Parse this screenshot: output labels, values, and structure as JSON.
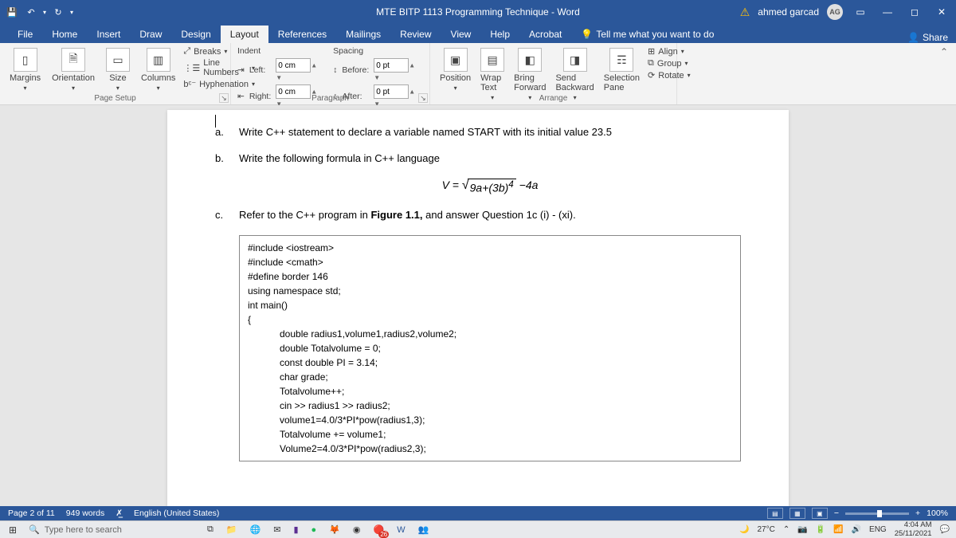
{
  "titlebar": {
    "title": "MTE BITP 1113 Programming Technique - Word",
    "username": "ahmed garcad",
    "avatar": "AG"
  },
  "tabs": {
    "file": "File",
    "items": [
      "Home",
      "Insert",
      "Draw",
      "Design",
      "Layout",
      "References",
      "Mailings",
      "Review",
      "View",
      "Help",
      "Acrobat"
    ],
    "tellme": "Tell me what you want to do",
    "share": "Share"
  },
  "ribbon": {
    "pagesetup": {
      "margins": "Margins",
      "orientation": "Orientation",
      "size": "Size",
      "columns": "Columns",
      "breaks": "Breaks",
      "linenumbers": "Line Numbers",
      "hyphenation": "Hyphenation",
      "label": "Page Setup"
    },
    "paragraph": {
      "indent": "Indent",
      "left_lbl": "Left:",
      "left_val": "0 cm",
      "right_lbl": "Right:",
      "right_val": "0 cm",
      "spacing": "Spacing",
      "before_lbl": "Before:",
      "before_val": "0 pt",
      "after_lbl": "After:",
      "after_val": "0 pt",
      "label": "Paragraph"
    },
    "arrange": {
      "position": "Position",
      "wrap": "Wrap Text",
      "forward": "Bring Forward",
      "backward": "Send Backward",
      "selection": "Selection Pane",
      "align": "Align",
      "group": "Group",
      "rotate": "Rotate",
      "label": "Arrange"
    }
  },
  "doc": {
    "qa_letter": "a.",
    "qa_text": "Write C++ statement to declare a variable named START with its initial value  23.5",
    "qb_letter": "b.",
    "qb_text": "Write the following formula in C++ language",
    "formula_lhs": "V =",
    "formula_rad": "9a+(3b)",
    "formula_sup": "4",
    "formula_tail": "−4a",
    "qc_letter": "c.",
    "qc_text_a": "Refer to the C++ program in ",
    "qc_text_b": "Figure 1.1,",
    "qc_text_c": "  and  answer Question 1c  (i) - (xi).",
    "code": {
      "l1": "#include <iostream>",
      "l2": "#include <cmath>",
      "l3": "#define border 146",
      "l4": "using namespace std;",
      "l5": "int main()",
      "l6": "{",
      "l7": "double radius1,volume1,radius2,volume2;",
      "l8": "double Totalvolume = 0;",
      "l9": "const double PI = 3.14;",
      "l10": "char grade;",
      "l11": "Totalvolume++;",
      "l12": "cin >> radius1 >> radius2;",
      "l13": "volume1=4.0/3*PI*pow(radius1,3);",
      "l14": "Totalvolume += volume1;",
      "l15": "Volume2=4.0/3*PI*pow(radius2,3);"
    }
  },
  "status": {
    "page": "Page 2 of 11",
    "words": "949 words",
    "lang": "English (United States)",
    "zoom": "100%"
  },
  "taskbar": {
    "search_placeholder": "Type here to search",
    "temp": "27°C",
    "lang": "ENG",
    "time": "4:04 AM",
    "date": "25/11/2021",
    "badge": "26"
  }
}
